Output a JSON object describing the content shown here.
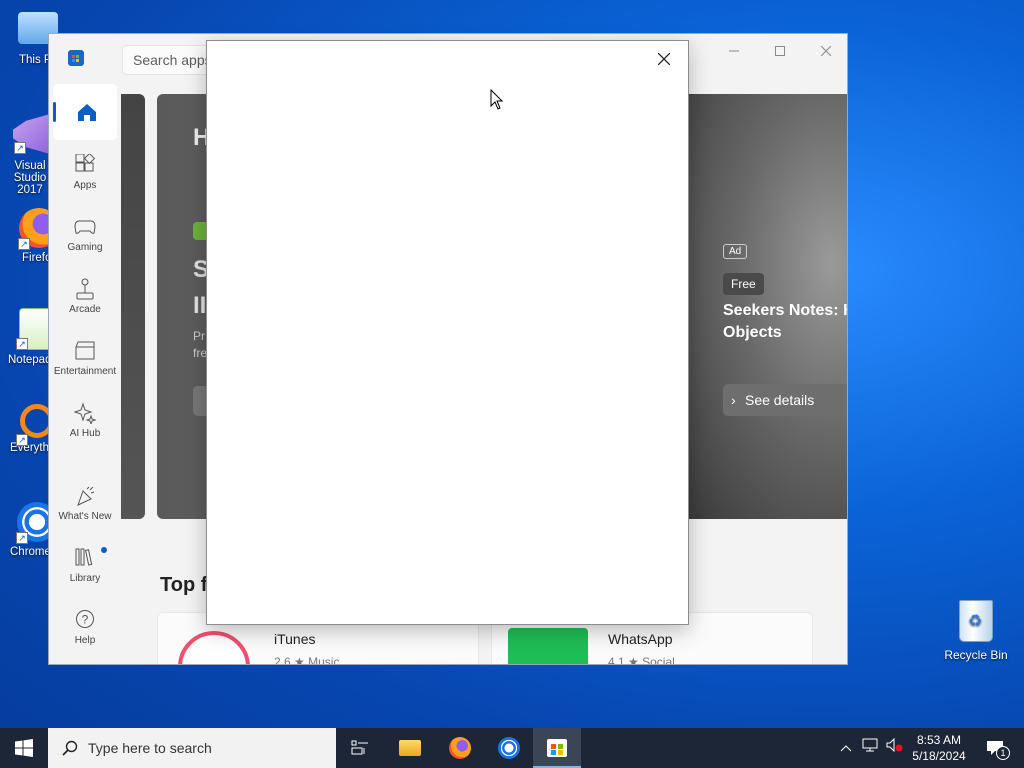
{
  "desktop": {
    "icons": [
      {
        "label": "This PC"
      },
      {
        "label": "Visual Studio 2017"
      },
      {
        "label": "Firefox"
      },
      {
        "label": "Notepad++"
      },
      {
        "label": "Everything"
      },
      {
        "label": "Chrome"
      }
    ],
    "recycle_bin": "Recycle Bin"
  },
  "store": {
    "search_placeholder": "Search apps",
    "nav": [
      {
        "label": "Apps",
        "icon": "apps-icon"
      },
      {
        "label": "Gaming",
        "icon": "gamepad-icon"
      },
      {
        "label": "Arcade",
        "icon": "joystick-icon"
      },
      {
        "label": "Entertainment",
        "icon": "clapperboard-icon"
      },
      {
        "label": "AI Hub",
        "icon": "sparkle-icon"
      },
      {
        "label": "What's New",
        "icon": "party-icon"
      },
      {
        "label": "Library",
        "icon": "library-icon"
      },
      {
        "label": "Help",
        "icon": "help-icon"
      }
    ],
    "hero_left": {
      "title": "H",
      "big": "S\nII",
      "small": "Pr\nfre"
    },
    "hero_right": {
      "ad": "Ad",
      "free": "Free",
      "title": "Seekers Notes: H Objects",
      "button": "See details"
    },
    "section_title": "Top f",
    "cards": [
      {
        "name": "iTunes",
        "meta": "2.6 ★  Music"
      },
      {
        "name": "WhatsApp",
        "meta": "4.1 ★  Social"
      }
    ]
  },
  "taskbar": {
    "search_placeholder": "Type here to search",
    "time": "8:53 AM",
    "date": "5/18/2024",
    "notification_count": "1"
  }
}
